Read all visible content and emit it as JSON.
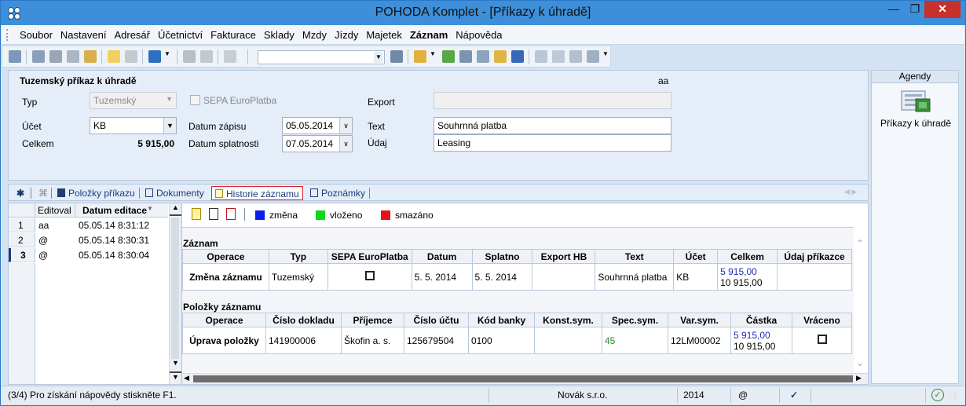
{
  "window": {
    "title": "POHODA Komplet - [Příkazy k úhradě]"
  },
  "menu": [
    "Soubor",
    "Nastavení",
    "Adresář",
    "Účetnictví",
    "Fakturace",
    "Sklady",
    "Mzdy",
    "Jízdy",
    "Majetek",
    "Záznam",
    "Nápověda"
  ],
  "form": {
    "title": "Tuzemský příkaz k úhradě",
    "user": "aa",
    "typ_label": "Typ",
    "typ_value": "Tuzemský",
    "sepa_label": "SEPA EuroPlatba",
    "export_label": "Export",
    "export_value": "",
    "ucet_label": "Účet",
    "ucet_value": "KB",
    "celkem_label": "Celkem",
    "celkem_value": "5 915,00",
    "datum_zapisu_label": "Datum zápisu",
    "datum_zapisu_value": "05.05.2014",
    "datum_splatnosti_label": "Datum splatnosti",
    "datum_splatnosti_value": "07.05.2014",
    "text_label": "Text",
    "text_value": "Souhrnná platba",
    "udaj_label": "Údaj",
    "udaj_value": "Leasing"
  },
  "agendy": {
    "title": "Agendy",
    "item_label": "Příkazy k úhradě"
  },
  "tabs": {
    "polozky": "Položky příkazu",
    "dokumenty": "Dokumenty",
    "historie": "Historie záznamu",
    "poznamky": "Poznámky"
  },
  "history_grid": {
    "col1": "Editoval",
    "col2": "Datum editace",
    "rows": [
      {
        "num": "1",
        "user": "aa",
        "date": "05.05.14 8:31:12"
      },
      {
        "num": "2",
        "user": "@",
        "date": "05.05.14 8:30:31"
      },
      {
        "num": "3",
        "user": "@",
        "date": "05.05.14 8:30:04"
      }
    ]
  },
  "legend": {
    "zmena": "změna",
    "vlozeno": "vloženo",
    "smazano": "smazáno"
  },
  "colors": {
    "zmena": "#0a1cf0",
    "vlozeno": "#0ad81a",
    "smazano": "#e0141a",
    "accent": "#3c8fd8"
  },
  "zaznam": {
    "section": "Záznam",
    "headers": [
      "Operace",
      "Typ",
      "SEPA EuroPlatba",
      "Datum",
      "Splatno",
      "Export HB",
      "Text",
      "Účet",
      "Celkem",
      "Údaj příkazce"
    ],
    "row": {
      "operace": "Změna záznamu",
      "typ": "Tuzemský",
      "datum": "5. 5. 2014",
      "splatno": "5. 5. 2014",
      "export_hb": "",
      "text": "Souhrnná platba",
      "ucet": "KB",
      "celkem_new": "5 915,00",
      "celkem_old": "10 915,00",
      "udaj": ""
    }
  },
  "polozky": {
    "section": "Položky záznamu",
    "headers": [
      "Operace",
      "Číslo dokladu",
      "Příjemce",
      "Číslo účtu",
      "Kód banky",
      "Konst.sym.",
      "Spec.sym.",
      "Var.sym.",
      "Částka",
      "Vráceno"
    ],
    "row": {
      "operace": "Úprava položky",
      "cislo_dokladu": "141900006",
      "prijemce": "Škofin a. s.",
      "cislo_uctu": "125679504",
      "kod_banky": "0100",
      "konst": "",
      "spec": "45",
      "var": "12LM00002",
      "castka_new": "5 915,00",
      "castka_old": "10 915,00"
    }
  },
  "status": {
    "help": "(3/4) Pro získání nápovědy stiskněte F1.",
    "company": "Novák s.r.o.",
    "year": "2014",
    "at": "@"
  }
}
